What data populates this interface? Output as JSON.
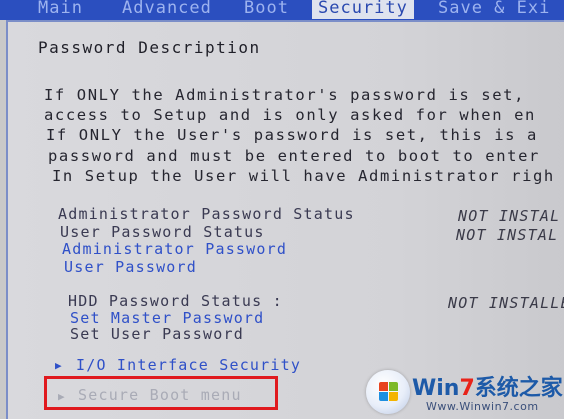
{
  "menu": {
    "tabs": [
      {
        "label": "Main"
      },
      {
        "label": "Advanced"
      },
      {
        "label": "Boot"
      },
      {
        "label": "Security"
      },
      {
        "label": "Save & Exi"
      }
    ]
  },
  "section_title": "Password Description",
  "description_lines": [
    "If ONLY the Administrator's password is set,",
    "access to Setup and is only asked for when en",
    "If ONLY the User's password is set, this is a",
    "password and must be entered to boot to enter",
    "In Setup the User will have Administrator righ"
  ],
  "admin_group": {
    "admin_status_label": "Administrator Password Status",
    "admin_status_value": "NOT INSTAL",
    "user_status_label": "User Password Status",
    "user_status_value": "NOT INSTAL",
    "admin_password_link": "Administrator Password",
    "user_password_link": "User Password"
  },
  "hdd_group": {
    "hdd_status_label": "HDD Password Status  :",
    "hdd_status_value": "NOT INSTALLE",
    "set_master_link": "Set Master Password",
    "set_user_label": "Set User Password"
  },
  "submenus": {
    "io_security": "I/O Interface Security",
    "secure_boot": "Secure Boot menu"
  },
  "watermark": {
    "brand_prefix": "Win",
    "brand_seven": "7",
    "brand_suffix": "系统之家",
    "url": "Www.Winwin7.com"
  },
  "colors": {
    "menubar": "#2b4fbf",
    "link": "#2f50c8",
    "highlight": "#e0191e"
  }
}
